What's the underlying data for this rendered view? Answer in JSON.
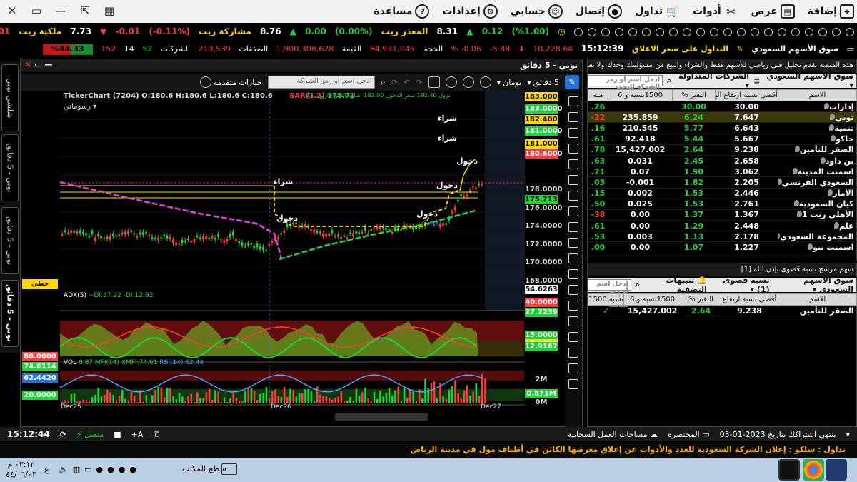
{
  "menu": {
    "items": [
      {
        "label": "إضافة",
        "icon": "plus-icon"
      },
      {
        "label": "عرض",
        "icon": "view-icon"
      },
      {
        "label": "أدوات",
        "icon": "tools-icon"
      },
      {
        "label": "تداول",
        "icon": "cart-icon"
      },
      {
        "label": "إتصال",
        "icon": "connect-icon"
      },
      {
        "label": "حسابي",
        "icon": "user-icon"
      },
      {
        "label": "إعدادات",
        "icon": "gear-icon"
      },
      {
        "label": "مساعدة",
        "icon": "help-icon"
      }
    ]
  },
  "ticker_top": {
    "a": "8.31",
    "a_label": "المعذر ريت",
    "a_chg": "0.12",
    "a_pct": "(%1.00)",
    "b": "8.76",
    "b_label": "مشاركة ريت",
    "b_chg": "0.00",
    "b_pct": "(%0.00)",
    "c": "7.73",
    "c_label": "ملكية ريت",
    "c_chg": "0.01-",
    "c_pct": "(%0.11-)",
    "d": "0.01-"
  },
  "ticker_bottom": {
    "market": "سوق الأسهم السعودي",
    "status": "التداول على سعر الاغلاق",
    "time": "15:12:39",
    "index": "10,228.64",
    "chg": "5.88-",
    "pct": "0.06- %",
    "vol_label": "الحجم",
    "vol": "84,931,045",
    "val_label": "القيمة",
    "val": "1,900,308,628",
    "deals_label": "الصفقات",
    "deals": "210,539",
    "cos_label": "الشركات",
    "up": "52",
    "flat": "14",
    "down": "152",
    "ratio": "%44.33"
  },
  "side_tabs": [
    "شلشي توبي",
    "توبي - 5 دقائق",
    "توبي - 5 دقائق",
    "توبي - 5 دقائق"
  ],
  "chart": {
    "title": "توبي - 5 دقائق",
    "interval": "5 دقائق",
    "period": "يومان",
    "options": "خيارات متقدمة",
    "search_placeholder": "ادخل اسم أو رمز الشركة",
    "brand": "TickerChart",
    "ohlc": "(7204) O:180.6 H:180.6 L:180.6 C:180.6",
    "sar": "SAR(1.2)",
    "sar_val": "175.71",
    "drawing_label": "رسوماتي",
    "line_type": "خطي",
    "info_line": "نزول 182.40 سعر الدخول 183.00 اشارة الشراء اربون 14",
    "adx_label": "ADX(5)",
    "adx_vals": "+DI:27.22  -DI:12.92",
    "vol_label": "VOL",
    "vol_val": "0.87",
    "mfi": "MFI(14)",
    "xmfi": "XMFI:74.61",
    "rsi": "RSI(14)",
    "rsi_val": "62.44",
    "dates": [
      "Dec25",
      "Dec26",
      "Dec27"
    ],
    "price_labels": [
      {
        "v": "183.0000",
        "c": "#ffd800"
      },
      {
        "v": "183.0000",
        "c": "#21d13a"
      },
      {
        "v": "182.4000",
        "c": "#ffd800"
      },
      {
        "v": "181.0000",
        "c": "#21d13a"
      },
      {
        "v": "181.0000",
        "c": "#ffd800"
      },
      {
        "v": "180.6000",
        "c": "#ff3b3b"
      }
    ],
    "axis_ticks": [
      "178.0000",
      "176.0000",
      "174.0000",
      "172.0000",
      "170.0000",
      "168.0000"
    ],
    "sar_tag": "175.7138",
    "low_tag": "54.6263",
    "adx_tags": [
      {
        "v": "40.0000",
        "c": "#ff3b3b"
      },
      {
        "v": "27.2239",
        "c": "#21d13a"
      },
      {
        "v": "15.0000",
        "c": "#21d13a"
      },
      {
        "v": "15.0000",
        "c": "#ffd800"
      },
      {
        "v": "12.9167",
        "c": "#21d13a"
      }
    ],
    "vol_tags": [
      {
        "v": "2M",
        "c": "#000"
      },
      {
        "v": "0.871M",
        "c": "#21d13a"
      },
      {
        "v": "0M",
        "c": "#000"
      }
    ],
    "rsi_left": [
      {
        "v": "80.0000",
        "c": "#ff3b3b"
      },
      {
        "v": "74.6114",
        "c": "#21d13a"
      },
      {
        "v": "62.4420",
        "c": "#2472d8"
      },
      {
        "v": "20.0000",
        "c": "#21d13a"
      }
    ],
    "annotations": {
      "buy1": "شراء",
      "buy2": "شراء",
      "buy3": "شراء",
      "entry1": "دخول",
      "entry2": "دخول",
      "entry3": "دخول",
      "entry4": "دخول"
    }
  },
  "panel1": {
    "title": "هذه المنصة تقدم تحليل فني رياضي للأسهم فقط والشراء والبيع من مسؤليتك وحدك ولا تعد",
    "market": "سوق الأسهم السعودي",
    "list": "الشركات المتداولة",
    "search": "ادخل اسم أو رمز الشركة للبحث",
    "headers": [
      "الاسم",
      "أقصى نسبه ارتفاع اليوم",
      "التغير %",
      "1500نسبه و 6",
      "منة"
    ],
    "rows": [
      [
        "إدارات",
        "30.00",
        "30.00",
        "",
        "26."
      ],
      [
        "توبي",
        "7.647",
        "6.24",
        "235.859",
        "22-"
      ],
      [
        "تنمية",
        "6.643",
        "5.77",
        "210.545",
        "16."
      ],
      [
        "جاكو",
        "5.667",
        "5.44",
        "92.418",
        "61."
      ],
      [
        "الصقر للتأمين",
        "9.238",
        "2.64",
        "15,427.002",
        "78."
      ],
      [
        "بن داود",
        "2.658",
        "2.45",
        "0.031",
        "63."
      ],
      [
        "اسمنت المدينة",
        "3.062",
        "1.90",
        "0.07",
        "21."
      ],
      [
        "السعودي الفرنسي",
        "2.205",
        "1.82",
        "0.001-",
        "03."
      ],
      [
        "الأمار",
        "2.446",
        "1.53",
        "0.002",
        "15."
      ],
      [
        "كيان السعودية",
        "2.761",
        "1.53",
        "0.025",
        "50."
      ],
      [
        "الأهلي ريت 1",
        "1.367",
        "1.37",
        "0.00",
        "38-"
      ],
      [
        "علم",
        "2.448",
        "1.29",
        "0.00",
        "61."
      ],
      [
        "المجموعة السعودي",
        "2.178",
        "1.13",
        "0.003",
        "53."
      ],
      [
        "اسمنت تبو",
        "1.227",
        "1.07",
        "0.00",
        "00."
      ]
    ]
  },
  "panel2": {
    "title": "سهم مرشح نسبه قصوى بإذن الله [1]",
    "market": "سوق الأسهم السعودي",
    "list": "نسبه قصوى (1)",
    "alerts": "تنبيهات التصفية",
    "search": "ادخل اسم أو رمز الشركة للبحث",
    "headers": [
      "الاسم",
      "أقصى نسبه ارتفاع",
      "التغير %",
      "1500نسبه و 6",
      "نسبه 1500 و 6"
    ],
    "rows": [
      [
        "الصقر للتأمين",
        "9.238",
        "2.64",
        "15,427.002",
        "✓"
      ]
    ]
  },
  "status": {
    "subscription": "ينتهي اشتراكك بتاريخ 2023-01-03",
    "mini": "المختصره",
    "cloud": "مساحات العمل السحابية",
    "connected": "متصل",
    "time": "15:12:44"
  },
  "news": "تداول : سلكو : إعلان الشركة السعودية للعدد والأدوات عن إغلاق معرضها الكائن في أطياف مول في مدينة الرياض",
  "taskbar": {
    "desktop": "سطح المكتب",
    "clock": "٠٣:١٢ م",
    "date": "٤٤/٠٦/٠٣",
    "lang": "ع"
  }
}
